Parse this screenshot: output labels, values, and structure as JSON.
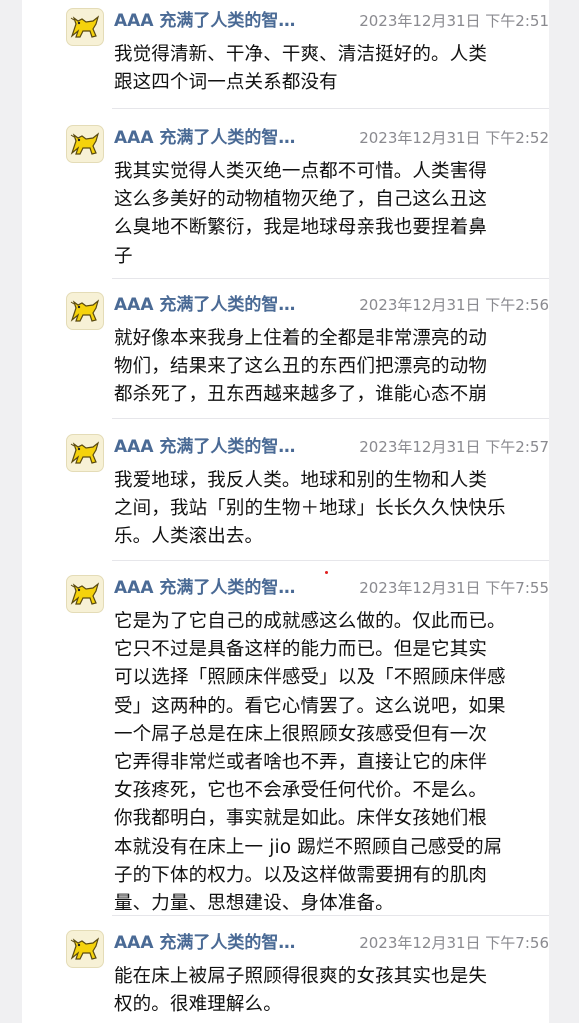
{
  "messages": [
    {
      "sender": "AAA 充满了人类的智…",
      "time": "2023年12月31日 下午2:51",
      "text": "我觉得清新、干净、干爽、清洁挺好的。人类\n跟这四个词一点关系都没有"
    },
    {
      "sender": "AAA 充满了人类的智…",
      "time": "2023年12月31日 下午2:52",
      "text": "我其实觉得人类灭绝一点都不可惜。人类害得\n这么多美好的动物植物灭绝了，自己这么丑这\n么臭地不断繁衍，我是地球母亲我也要捏着鼻\n子"
    },
    {
      "sender": "AAA 充满了人类的智…",
      "time": "2023年12月31日 下午2:56",
      "text": "就好像本来我身上住着的全都是非常漂亮的动\n物们，结果来了这么丑的东西们把漂亮的动物\n都杀死了，丑东西越来越多了，谁能心态不崩"
    },
    {
      "sender": "AAA 充满了人类的智…",
      "time": "2023年12月31日 下午2:57",
      "text": "我爱地球，我反人类。地球和别的生物和人类\n之间，我站「别的生物＋地球」长长久久快快乐\n乐。人类滚出去。"
    },
    {
      "sender": "AAA 充满了人类的智…",
      "time": "2023年12月31日 下午7:55",
      "text": "它是为了它自己的成就感这么做的。仅此而已。\n它只不过是具备这样的能力而已。但是它其实\n可以选择「照顾床伴感受」以及「不照顾床伴感\n受」这两种的。看它心情罢了。这么说吧，如果\n一个屌子总是在床上很照顾女孩感受但有一次\n它弄得非常烂或者啥也不弄，直接让它的床伴\n女孩疼死，它也不会承受任何代价。不是么。\n你我都明白，事实就是如此。床伴女孩她们根\n本就没有在床上一 jio 踢烂不照顾自己感受的屌\n子的下体的权力。以及这样做需要拥有的肌肉\n量、力量、思想建设、身体准备。"
    },
    {
      "sender": "AAA 充满了人类的智…",
      "time": "2023年12月31日 下午7:56",
      "text": "能在床上被屌子照顾得很爽的女孩其实也是失\n权的。很难理解么。"
    }
  ],
  "avatar_icon": "yellow-dog-avatar-icon",
  "colors": {
    "sender": "#4a6a95",
    "time": "#8a8a8f",
    "text": "#111111",
    "gutter": "#f0f0f2"
  }
}
